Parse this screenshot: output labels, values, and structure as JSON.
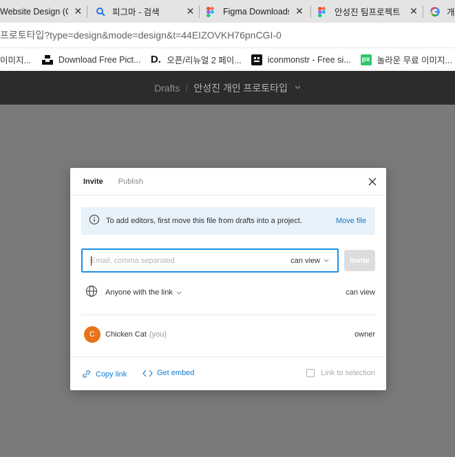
{
  "tabs": [
    {
      "title": "Website Design (C",
      "icon": "figma-icon"
    },
    {
      "title": "피그마 - 검색",
      "icon": "search-icon"
    },
    {
      "title": "Figma Downloads",
      "icon": "figma-icon"
    },
    {
      "title": "안성진 팀프로젝트",
      "icon": "figma-icon"
    },
    {
      "title": "개",
      "icon": "google-icon"
    }
  ],
  "address": {
    "url": "프로토타입?type=design&mode=design&t=44EIZOVKH76pnCGI-0"
  },
  "bookmarks": [
    {
      "label": "이미지...",
      "icon": "image-icon"
    },
    {
      "label": "Download Free Pict...",
      "icon": "unsplash-icon"
    },
    {
      "label": "오픈/리뉴얼 2 페이...",
      "icon": "d-logo-icon"
    },
    {
      "label": "iconmonstr - Free si...",
      "icon": "iconmonstr-icon"
    },
    {
      "label": "놀라운 무료 이미지...",
      "icon": "pixabay-icon"
    }
  ],
  "header": {
    "crumb": "Drafts",
    "separator": "/",
    "file_name": "안성진 개인 프로토타입"
  },
  "modal": {
    "tabs": [
      {
        "label": "Invite",
        "active": true
      },
      {
        "label": "Publish",
        "active": false
      }
    ],
    "banner": {
      "text": "To add editors, first move this file from drafts into a project.",
      "link": "Move file"
    },
    "email": {
      "placeholder": "Email, comma separated",
      "value": "",
      "permission": "can view"
    },
    "invite_button": "Invite",
    "link_access": {
      "label": "Anyone with the link",
      "permission": "can view"
    },
    "user": {
      "initial": "C",
      "name": "Chicken Cat",
      "you": "(you)",
      "role": "owner",
      "avatar_color": "#e8731a"
    },
    "footer": {
      "copy_link": "Copy link",
      "get_embed": "Get embed",
      "link_to_selection": "Link to selection"
    }
  },
  "colors": {
    "accent": "#1478c8",
    "focus_border": "#1a8ee6",
    "banner_bg": "#e7f2fb",
    "header_bg": "#2c2c2c",
    "overlay_bg": "#7a7a7a"
  }
}
